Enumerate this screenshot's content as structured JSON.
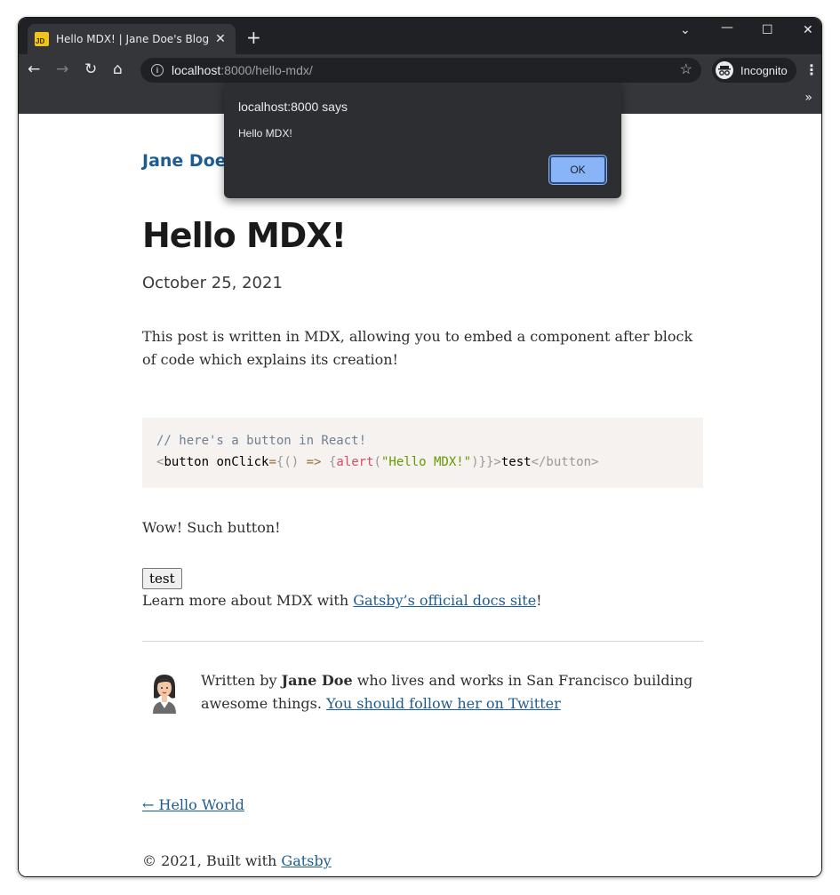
{
  "browser": {
    "tab_title": "Hello MDX! | Jane Doe's Blog",
    "tab_favicon_text": "JD",
    "url_host": "localhost",
    "url_path": ":8000/hello-mdx/",
    "incognito_label": "Incognito",
    "icons": [
      "back-arrow-icon",
      "forward-arrow-icon",
      "reload-icon",
      "home-icon",
      "info-icon",
      "star-icon",
      "incognito-icon",
      "menu-dots-icon"
    ]
  },
  "dialog": {
    "title": "localhost:8000 says",
    "message": "Hello MDX!",
    "ok_label": "OK"
  },
  "page": {
    "site_title": "Jane Doe",
    "post_title": "Hello MDX!",
    "post_date": "October 25, 2021",
    "intro": "This post is written in MDX, allowing you to embed a component after block of code which explains its creation!",
    "code": {
      "comment": "// here's a button in React!",
      "lt": "<",
      "tag": "button",
      "space": " ",
      "attr": "onClick",
      "eq": "=",
      "brace_open": "{",
      "paren_pair": "()",
      "arrow": " =>",
      "space2": " ",
      "inner_brace": "{",
      "fn": "alert",
      "paren_open": "(",
      "str": "\"Hello MDX!\"",
      "paren_close": ")",
      "braces_close": "}}",
      "gt": ">",
      "text": "test",
      "close_tag": "</button>"
    },
    "wow": "Wow! Such button!",
    "test_button_label": "test",
    "learn_prefix": "Learn more about MDX with ",
    "learn_link": "Gatsby’s official docs site",
    "learn_suffix": "!",
    "bio_prefix": "Written by ",
    "bio_name": "Jane Doe",
    "bio_middle": " who lives and works in San Francisco building awesome things. ",
    "bio_link": "You should follow her on Twitter",
    "prev_link": "← Hello World",
    "footer_prefix": "© 2021, Built with ",
    "footer_link": "Gatsby"
  }
}
